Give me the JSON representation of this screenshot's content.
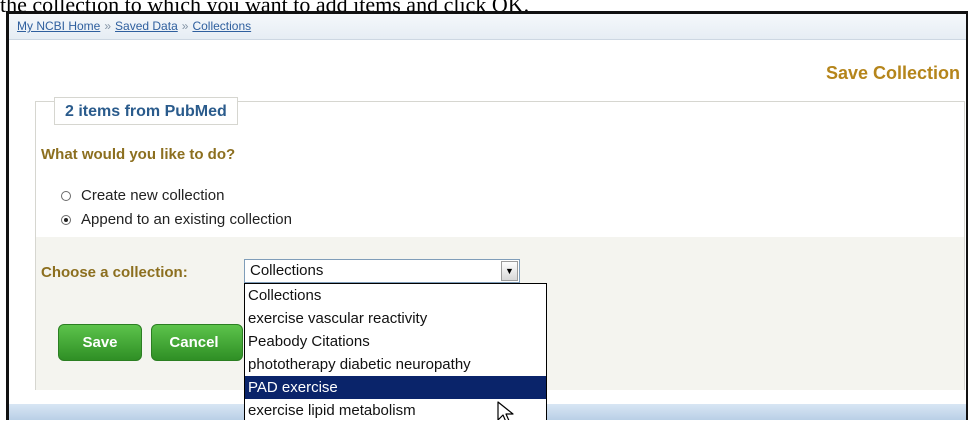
{
  "caption": "the collection to which you want to add items and click OK.",
  "breadcrumb": [
    "My NCBI Home",
    "Saved Data",
    "Collections"
  ],
  "page_title": "Save Collection",
  "legend": "2 items from PubMed",
  "question": "What would you like to do?",
  "options": [
    {
      "label": "Create new collection",
      "checked": false
    },
    {
      "label": "Append to an existing collection",
      "checked": true
    }
  ],
  "choose_label": "Choose a collection:",
  "select_value": "Collections",
  "dropdown_items": [
    "Collections",
    "exercise vascular reactivity",
    "Peabody Citations",
    "phototherapy diabetic neuropathy",
    "PAD exercise",
    "exercise lipid metabolism"
  ],
  "highlighted_item": "PAD exercise",
  "buttons": {
    "save": "Save",
    "cancel": "Cancel"
  }
}
